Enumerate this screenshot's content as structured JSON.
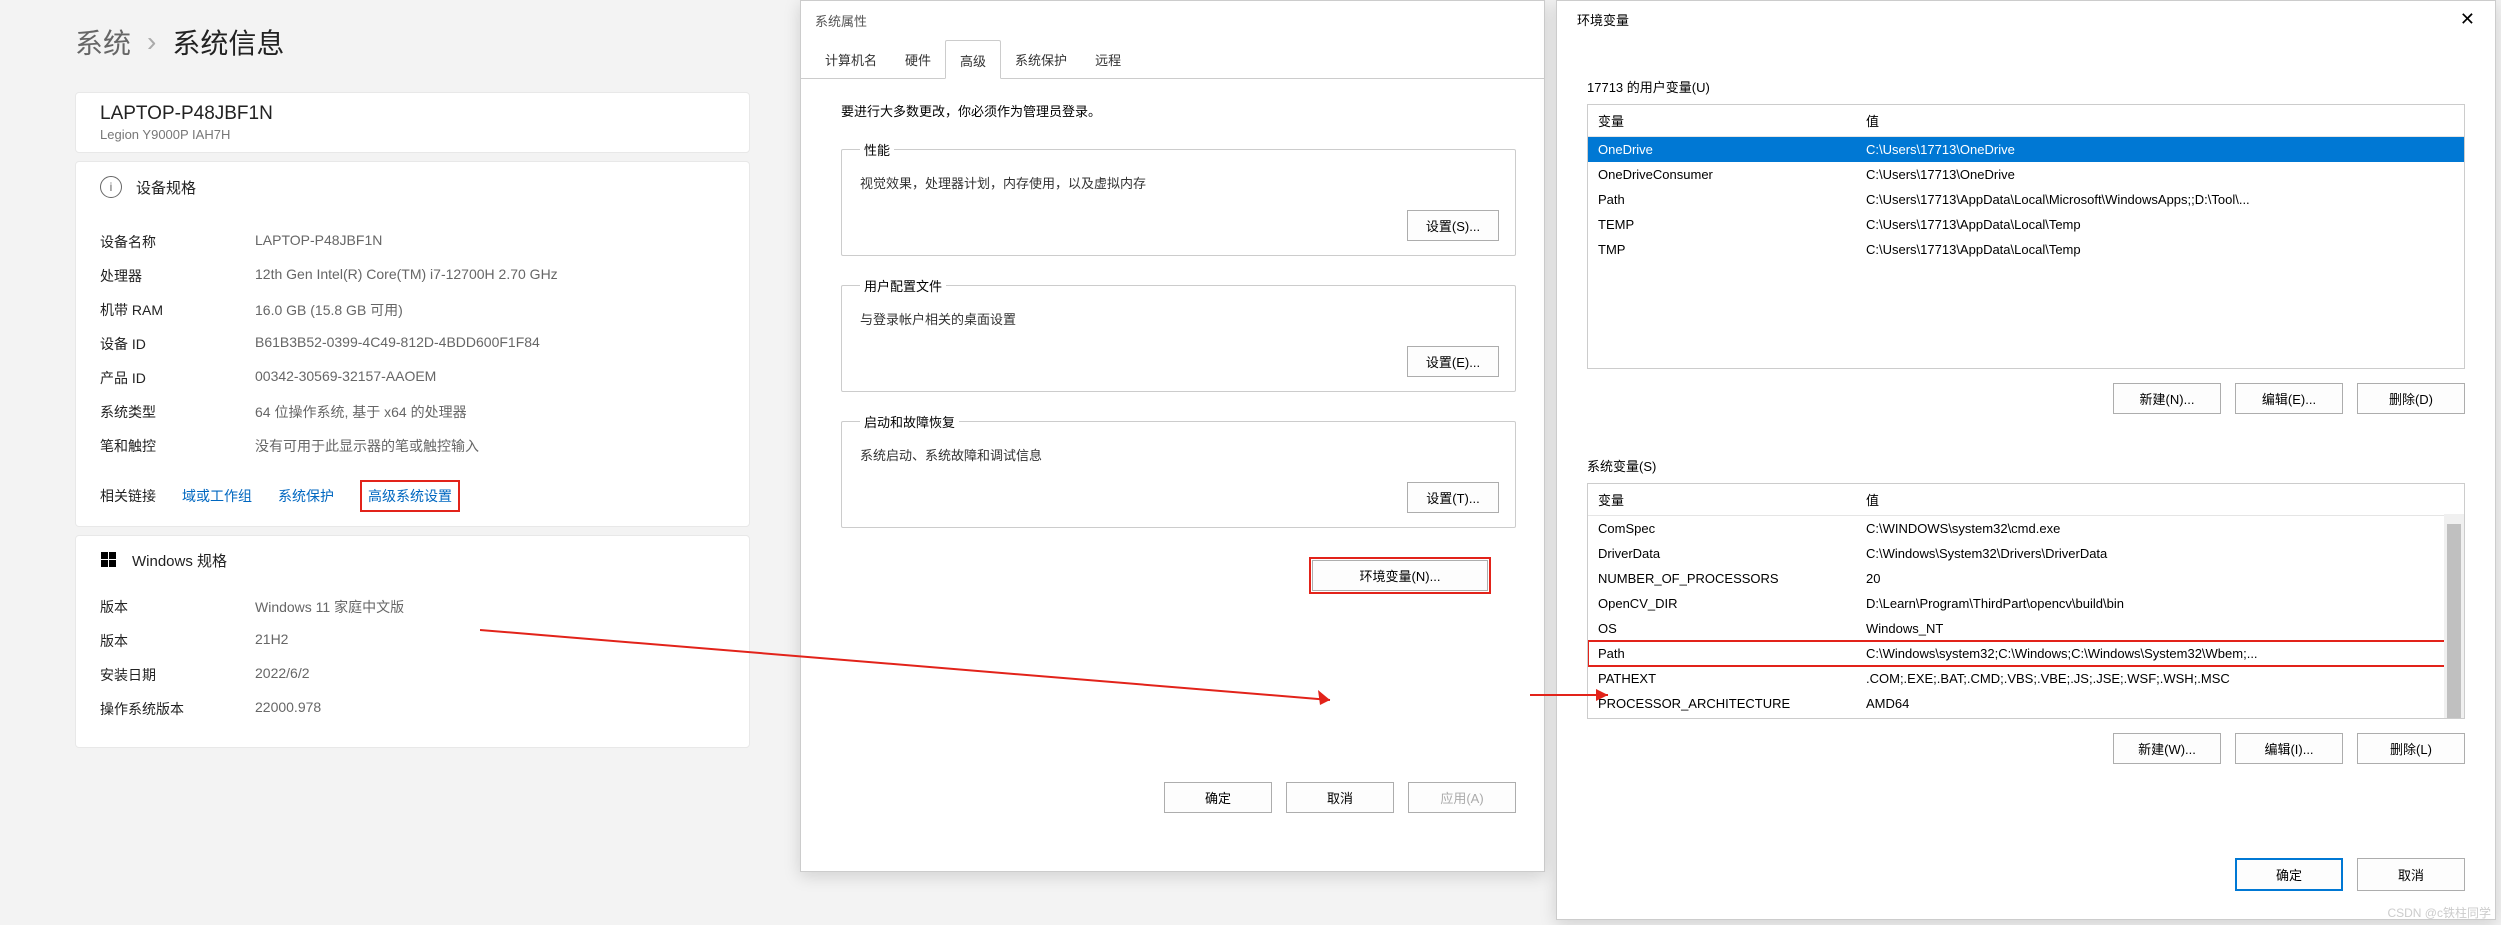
{
  "breadcrumb": {
    "root": "系统",
    "sep": "›",
    "current": "系统信息"
  },
  "device_card": {
    "name": "LAPTOP-P48JBF1N",
    "model": "Legion Y9000P IAH7H"
  },
  "specs": {
    "header": "设备规格",
    "rows": [
      {
        "label": "设备名称",
        "value": "LAPTOP-P48JBF1N"
      },
      {
        "label": "处理器",
        "value": "12th Gen Intel(R) Core(TM) i7-12700H   2.70 GHz"
      },
      {
        "label": "机带 RAM",
        "value": "16.0 GB (15.8 GB 可用)"
      },
      {
        "label": "设备 ID",
        "value": "B61B3B52-0399-4C49-812D-4BDD600F1F84"
      },
      {
        "label": "产品 ID",
        "value": "00342-30569-32157-AAOEM"
      },
      {
        "label": "系统类型",
        "value": "64 位操作系统, 基于 x64 的处理器"
      },
      {
        "label": "笔和触控",
        "value": "没有可用于此显示器的笔或触控输入"
      }
    ],
    "related_label": "相关链接",
    "links": [
      "域或工作组",
      "系统保护",
      "高级系统设置"
    ]
  },
  "windows_specs": {
    "header": "Windows 规格",
    "rows": [
      {
        "label": "版本",
        "value": "Windows 11 家庭中文版"
      },
      {
        "label": "版本",
        "value": "21H2"
      },
      {
        "label": "安装日期",
        "value": "2022/6/2"
      },
      {
        "label": "操作系统版本",
        "value": "22000.978"
      }
    ]
  },
  "sysprop": {
    "title": "系统属性",
    "tabs": [
      "计算机名",
      "硬件",
      "高级",
      "系统保护",
      "远程"
    ],
    "admin_note": "要进行大多数更改，你必须作为管理员登录。",
    "perf": {
      "legend": "性能",
      "desc": "视觉效果，处理器计划，内存使用，以及虚拟内存",
      "btn": "设置(S)..."
    },
    "profiles": {
      "legend": "用户配置文件",
      "desc": "与登录帐户相关的桌面设置",
      "btn": "设置(E)..."
    },
    "startup": {
      "legend": "启动和故障恢复",
      "desc": "系统启动、系统故障和调试信息",
      "btn": "设置(T)..."
    },
    "env_btn": "环境变量(N)...",
    "buttons": {
      "ok": "确定",
      "cancel": "取消",
      "apply": "应用(A)"
    }
  },
  "envvar": {
    "title": "环境变量",
    "user_label": "17713 的用户变量(U)",
    "headers": {
      "name": "变量",
      "value": "值"
    },
    "user_vars": [
      {
        "name": "OneDrive",
        "value": "C:\\Users\\17713\\OneDrive",
        "selected": true
      },
      {
        "name": "OneDriveConsumer",
        "value": "C:\\Users\\17713\\OneDrive"
      },
      {
        "name": "Path",
        "value": "C:\\Users\\17713\\AppData\\Local\\Microsoft\\WindowsApps;;D:\\Tool\\..."
      },
      {
        "name": "TEMP",
        "value": "C:\\Users\\17713\\AppData\\Local\\Temp"
      },
      {
        "name": "TMP",
        "value": "C:\\Users\\17713\\AppData\\Local\\Temp"
      }
    ],
    "sys_label": "系统变量(S)",
    "sys_vars": [
      {
        "name": "ComSpec",
        "value": "C:\\WINDOWS\\system32\\cmd.exe"
      },
      {
        "name": "DriverData",
        "value": "C:\\Windows\\System32\\Drivers\\DriverData"
      },
      {
        "name": "NUMBER_OF_PROCESSORS",
        "value": "20"
      },
      {
        "name": "OpenCV_DIR",
        "value": "D:\\Learn\\Program\\ThirdPart\\opencv\\build\\bin"
      },
      {
        "name": "OS",
        "value": "Windows_NT"
      },
      {
        "name": "Path",
        "value": "C:\\Windows\\system32;C:\\Windows;C:\\Windows\\System32\\Wbem;...",
        "path_hl": true
      },
      {
        "name": "PATHEXT",
        "value": ".COM;.EXE;.BAT;.CMD;.VBS;.VBE;.JS;.JSE;.WSF;.WSH;.MSC"
      },
      {
        "name": "PROCESSOR_ARCHITECTURE",
        "value": "AMD64"
      }
    ],
    "btns": {
      "new_user": "新建(N)...",
      "edit_user": "编辑(E)...",
      "del_user": "删除(D)",
      "new_sys": "新建(W)...",
      "edit_sys": "编辑(I)...",
      "del_sys": "删除(L)",
      "ok": "确定",
      "cancel": "取消"
    }
  },
  "watermark": "CSDN @c铁柱同学"
}
